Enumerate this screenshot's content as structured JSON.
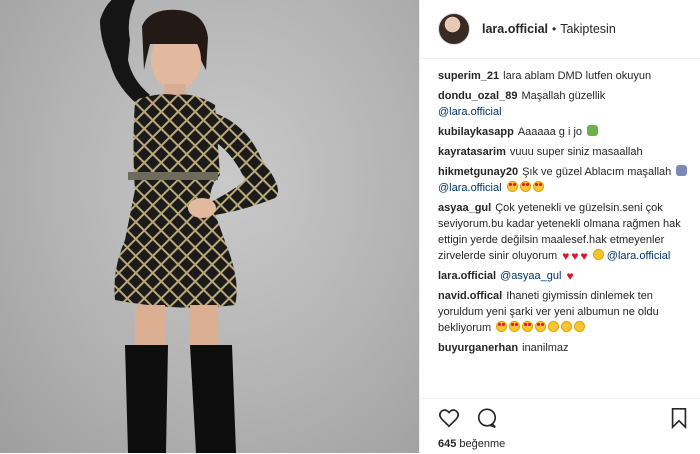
{
  "post": {
    "username": "lara.official",
    "separator": "•",
    "follow_status": "Takiptesin"
  },
  "comments": [
    {
      "user": "superim_21",
      "text": "lara ablam DMD lutfen okuyun"
    },
    {
      "user": "dondu_ozal_89",
      "text": "Maşallah güzellik",
      "mention": "@lara.official"
    },
    {
      "user": "kubilaykasapp",
      "text": "Aaaaaa g i jo"
    },
    {
      "user": "kayratasarim",
      "text": "vuuu super siniz masaallah"
    },
    {
      "user": "hikmetgunay20",
      "text": "Şık ve güzel Ablacım maşallah",
      "mention": "@lara.official"
    },
    {
      "user": "asyaa_gul",
      "text": "Çok yetenekli ve güzelsin.seni çok seviyorum.bu kadar yetenekli olmana rağmen hak ettigin yerde değilsin maalesef.hak etmeyenler zirvelerde sinir oluyorum",
      "mention": "@lara.official"
    },
    {
      "user": "lara.official",
      "mention": "@asyaa_gul"
    },
    {
      "user": "navid.offical",
      "text": "Ihaneti giymissin dinlemek ten yoruldum yeni şarki ver yeni albumun ne oldu bekliyorum"
    },
    {
      "user": "buyurganerhan",
      "text": "inanilmaz"
    }
  ],
  "likes": {
    "count": "645",
    "label": "beğenme"
  },
  "icons": {
    "like": "heart-outline-icon",
    "comment": "comment-bubble-icon",
    "save": "bookmark-icon"
  },
  "colors": {
    "mention": "#003569",
    "heart_emoji": "#e0132b"
  }
}
